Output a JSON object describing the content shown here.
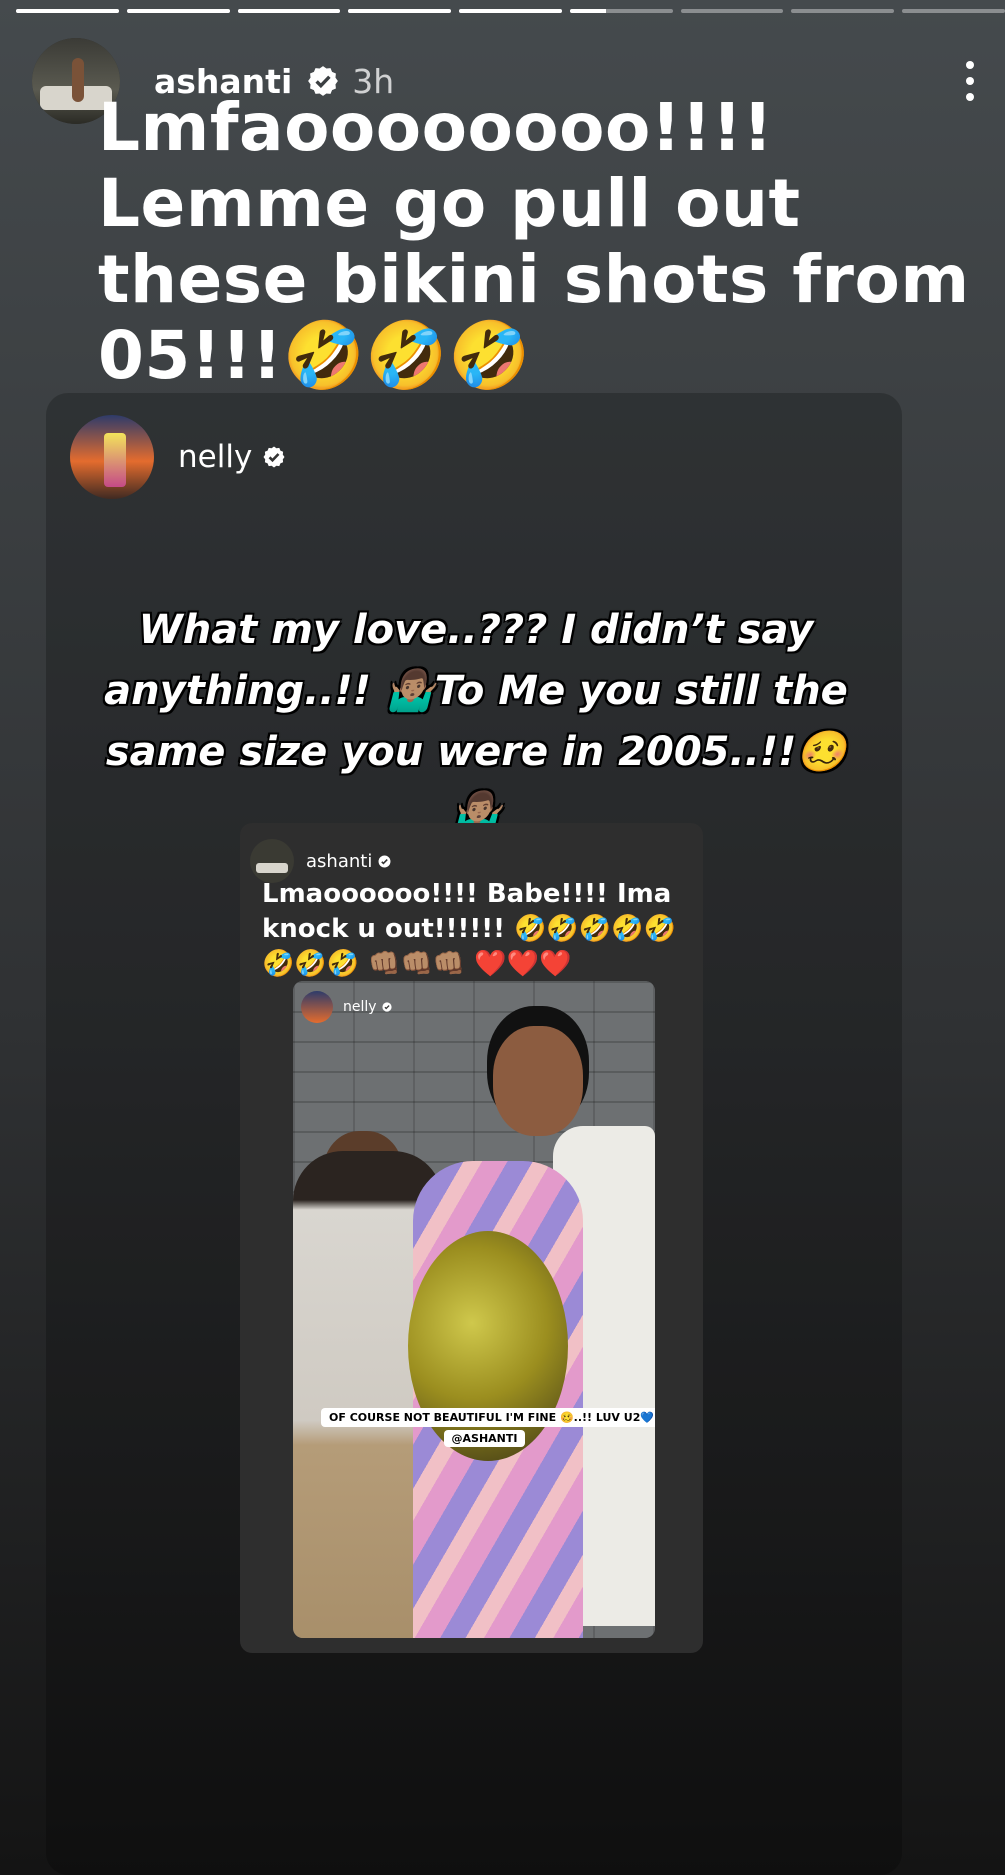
{
  "story": {
    "progress_segments": 9,
    "progress_current_index": 5,
    "progress_current_fraction": 0.35
  },
  "header": {
    "username": "ashanti",
    "time_ago": "3h",
    "verified_icon": "verified-badge-icon",
    "more_icon": "more-options-icon"
  },
  "caption": {
    "lines": [
      "Lmfaoooooooo!!!!",
      "Lemme go pull out",
      "these bikini shots from",
      "05!!!🤣🤣🤣"
    ]
  },
  "shared_post": {
    "username": "nelly",
    "text": "What my love..??? I didn’t say anything..!! 🤷🏽‍♂️To Me you still the same size you were in 2005..!!🥴🤷🏽‍♂️",
    "inner_story": {
      "username": "ashanti",
      "caption_lines": [
        "Lmaoooooo!!!! Babe!!!! Ima",
        "knock u out!!!!!! 🤣🤣🤣🤣🤣",
        "🤣🤣🤣 👊🏽👊🏽👊🏽 ❤️❤️❤️"
      ],
      "photo": {
        "username": "nelly",
        "caption_line1": "OF COURSE NOT BEAUTIFUL I'M FINE 🥴..!! LUV U2💙",
        "caption_line2": "@ASHANTI"
      }
    }
  },
  "colors": {
    "verified": "#ffffff",
    "background_top": "#454a4d",
    "background_bottom": "#141414"
  }
}
